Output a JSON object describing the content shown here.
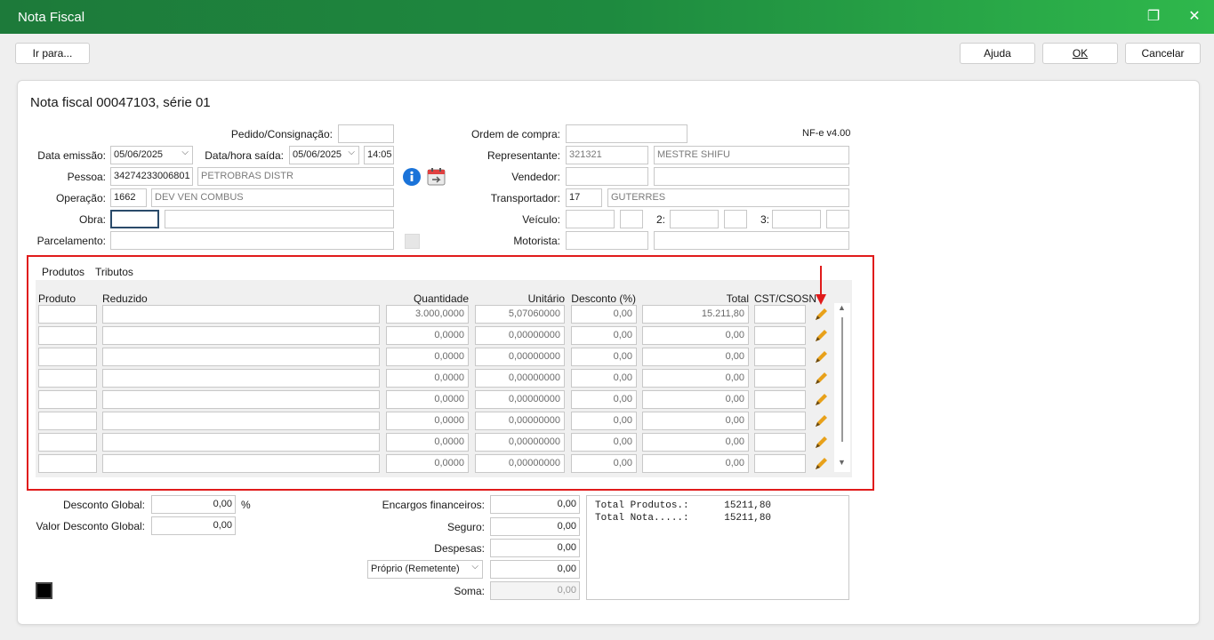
{
  "window": {
    "title": "Nota Fiscal"
  },
  "toolbar": {
    "goto_label": "Ir para...",
    "help_label": "Ajuda",
    "ok_label": "OK",
    "cancel_label": "Cancelar"
  },
  "header": {
    "heading": "Nota fiscal 00047103, série 01",
    "nfe_version": "NF-e v4.00"
  },
  "form": {
    "pedido_label": "Pedido/Consignação:",
    "pedido_value": "",
    "data_emissao_label": "Data emissão:",
    "data_emissao_value": "05/06/2025",
    "data_saida_label": "Data/hora saída:",
    "data_saida_value": "05/06/2025",
    "hora_saida_value": "14:05",
    "pessoa_label": "Pessoa:",
    "pessoa_code": "34274233006801",
    "pessoa_name": "PETROBRAS DISTR",
    "operacao_label": "Operação:",
    "operacao_code": "1662",
    "operacao_name": "DEV VEN COMBUS",
    "obra_label": "Obra:",
    "obra_code": "",
    "obra_name": "",
    "parcelamento_label": "Parcelamento:",
    "parcelamento_value": "",
    "ordem_compra_label": "Ordem de compra:",
    "ordem_compra_value": "",
    "representante_label": "Representante:",
    "representante_code": "321321",
    "representante_name": "MESTRE SHIFU",
    "vendedor_label": "Vendedor:",
    "vendedor_code": "",
    "vendedor_name": "",
    "transportador_label": "Transportador:",
    "transportador_code": "17",
    "transportador_name": "GUTERRES",
    "veiculo_label": "Veículo:",
    "veiculo2_label": "2:",
    "veiculo3_label": "3:",
    "motorista_label": "Motorista:"
  },
  "tabs": [
    {
      "label": "Produtos",
      "active": true
    },
    {
      "label": "Tributos",
      "active": false
    }
  ],
  "grid": {
    "columns": {
      "produto": "Produto",
      "reduzido": "Reduzido",
      "quantidade": "Quantidade",
      "unitario": "Unitário",
      "desconto": "Desconto (%)",
      "total": "Total",
      "cst": "CST/CSOSN"
    },
    "rows": [
      {
        "produto": "",
        "reduzido": "",
        "quantidade": "3.000,0000",
        "unitario": "5,07060000",
        "desconto": "0,00",
        "total": "15.211,80",
        "cst": ""
      },
      {
        "produto": "",
        "reduzido": "",
        "quantidade": "0,0000",
        "unitario": "0,00000000",
        "desconto": "0,00",
        "total": "0,00",
        "cst": ""
      },
      {
        "produto": "",
        "reduzido": "",
        "quantidade": "0,0000",
        "unitario": "0,00000000",
        "desconto": "0,00",
        "total": "0,00",
        "cst": ""
      },
      {
        "produto": "",
        "reduzido": "",
        "quantidade": "0,0000",
        "unitario": "0,00000000",
        "desconto": "0,00",
        "total": "0,00",
        "cst": ""
      },
      {
        "produto": "",
        "reduzido": "",
        "quantidade": "0,0000",
        "unitario": "0,00000000",
        "desconto": "0,00",
        "total": "0,00",
        "cst": ""
      },
      {
        "produto": "",
        "reduzido": "",
        "quantidade": "0,0000",
        "unitario": "0,00000000",
        "desconto": "0,00",
        "total": "0,00",
        "cst": ""
      },
      {
        "produto": "",
        "reduzido": "",
        "quantidade": "0,0000",
        "unitario": "0,00000000",
        "desconto": "0,00",
        "total": "0,00",
        "cst": ""
      },
      {
        "produto": "",
        "reduzido": "",
        "quantidade": "0,0000",
        "unitario": "0,00000000",
        "desconto": "0,00",
        "total": "0,00",
        "cst": ""
      }
    ]
  },
  "footer": {
    "desconto_global_label": "Desconto Global:",
    "desconto_global_value": "0,00",
    "percent_sign": "%",
    "valor_desconto_label": "Valor Desconto Global:",
    "valor_desconto_value": "0,00",
    "encargos_label": "Encargos financeiros:",
    "encargos_value": "0,00",
    "seguro_label": "Seguro:",
    "seguro_value": "0,00",
    "despesas_label": "Despesas:",
    "despesas_value": "0,00",
    "frete_option": "Próprio (Remetente)",
    "frete_value": "0,00",
    "soma_label": "Soma:",
    "soma_value": "0,00",
    "summary_line1": "Total Produtos.:      15211,80",
    "summary_line2": "Total Nota.....:      15211,80"
  },
  "colors": {
    "accent": "#1e8a3f",
    "highlight": "#e01b1b",
    "pencil": "#e8a11a",
    "info": "#1a73d9"
  }
}
